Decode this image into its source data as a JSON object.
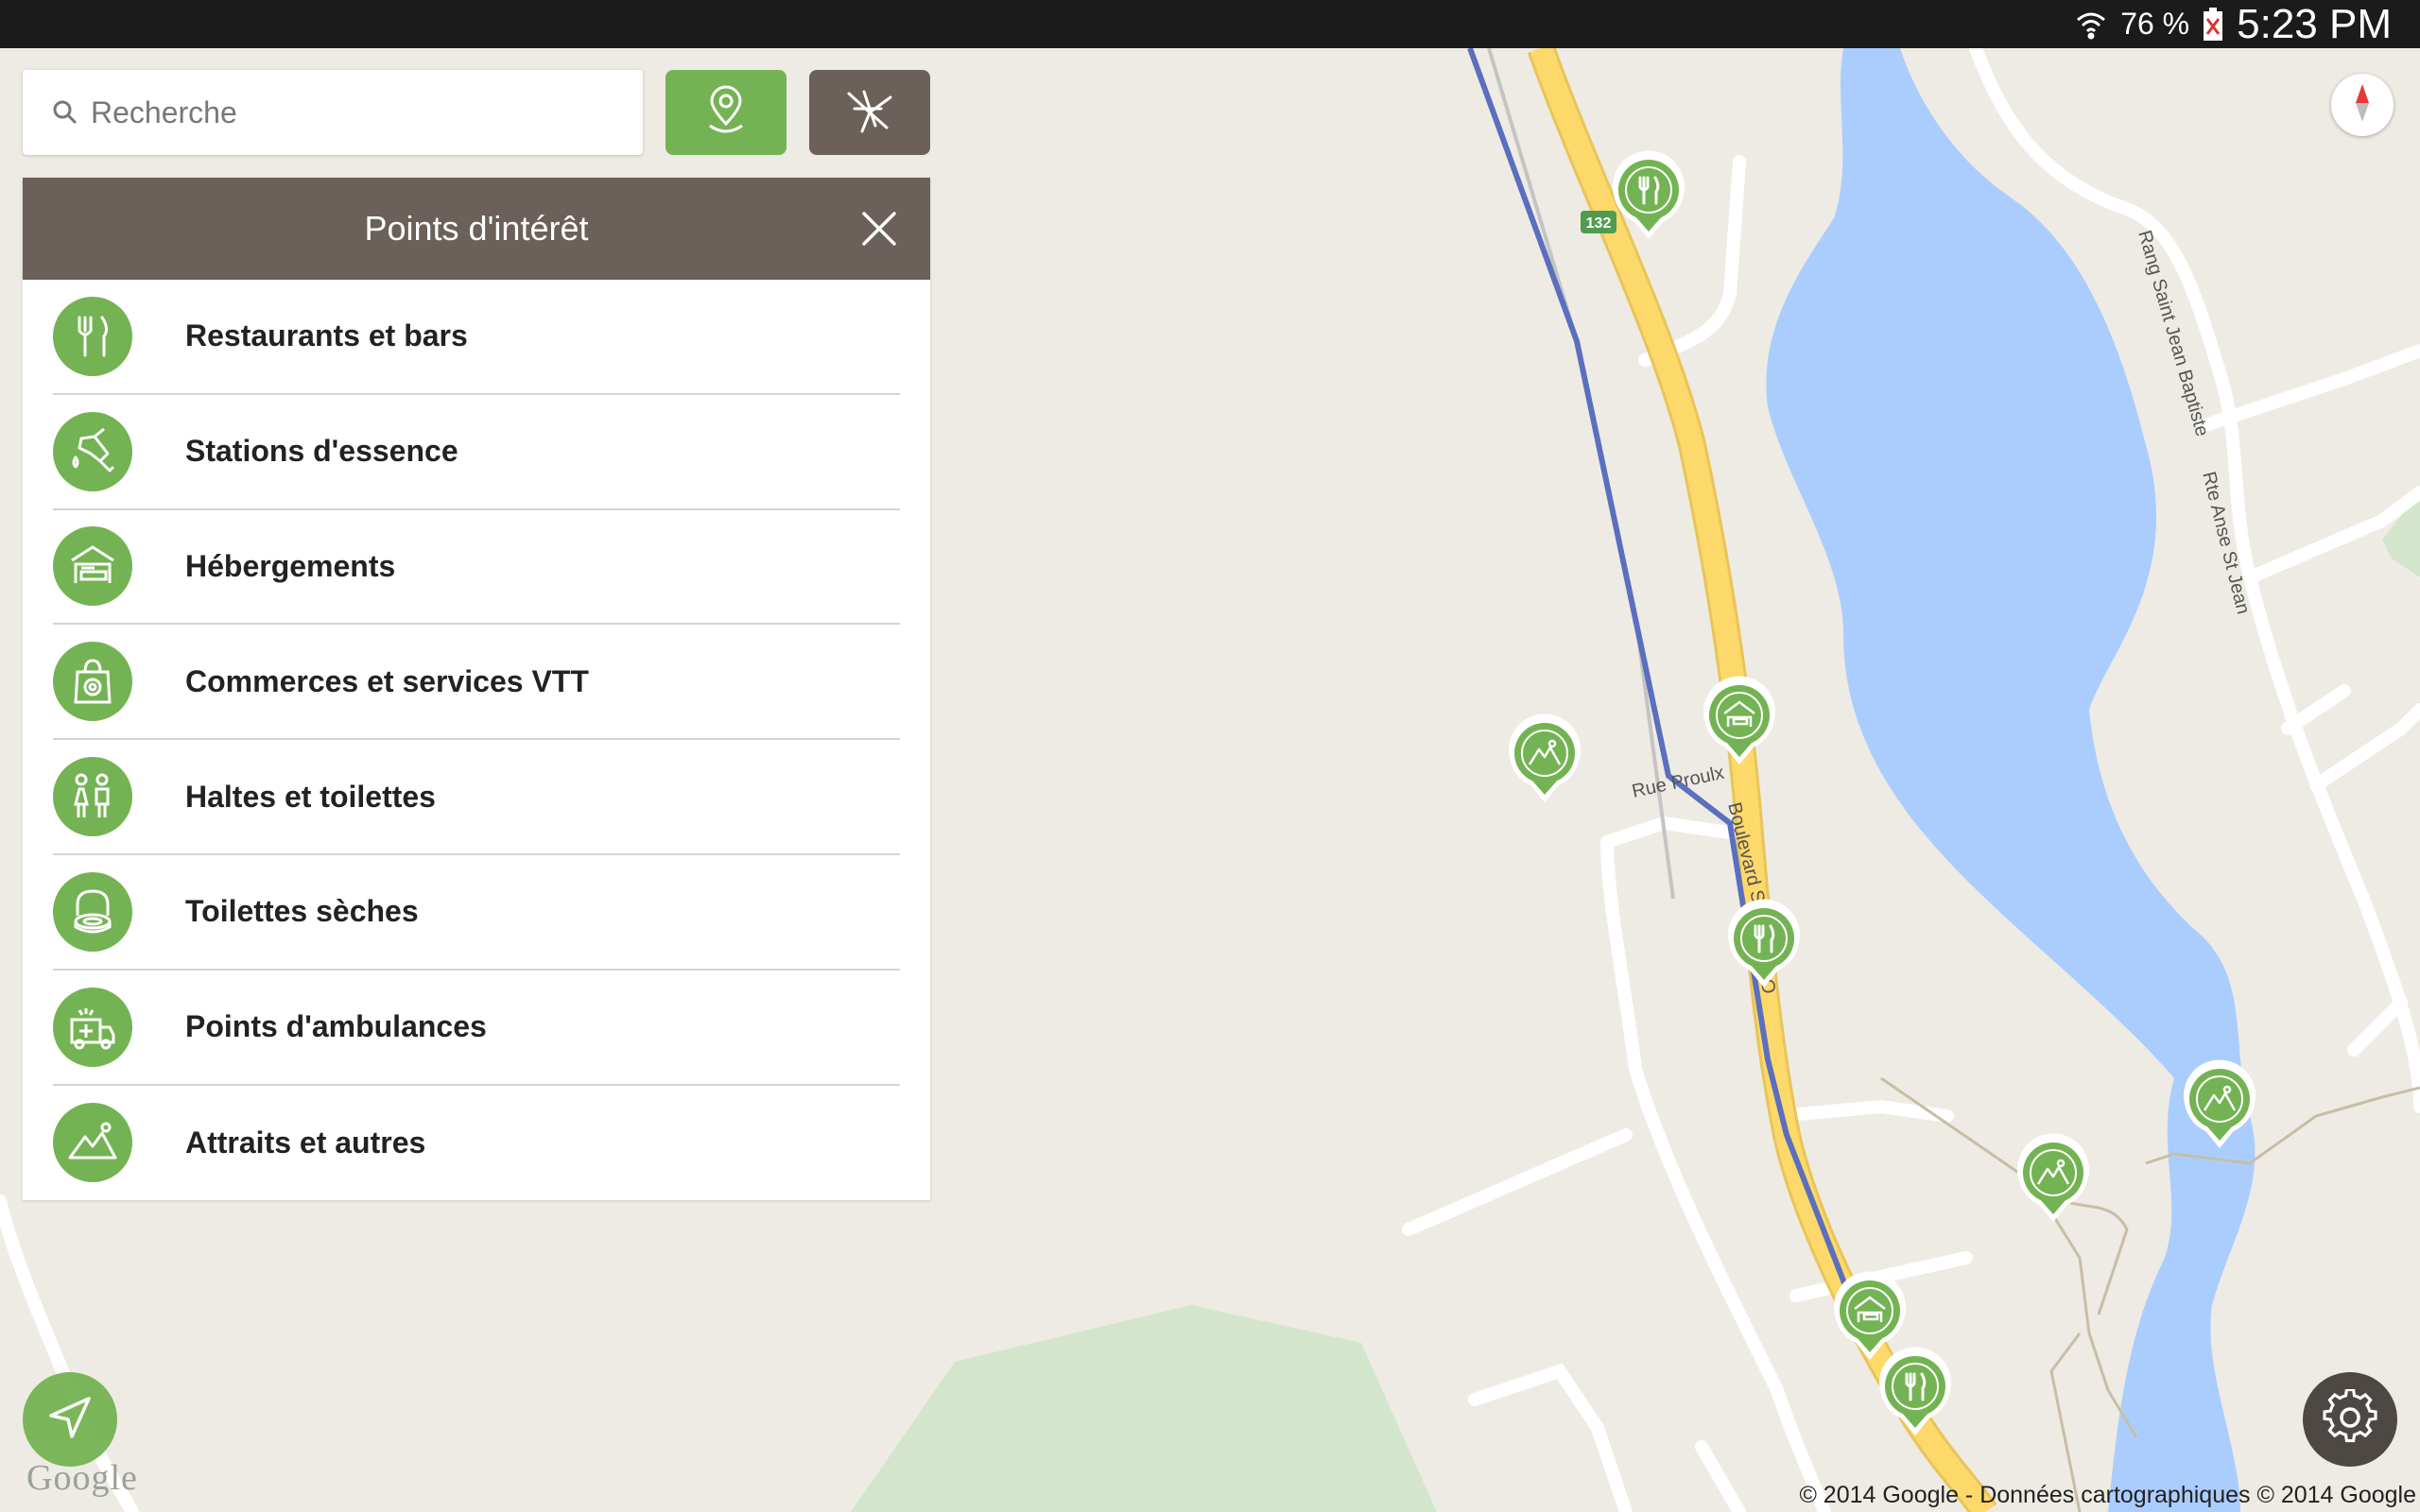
{
  "status_bar": {
    "battery_percent": "76 %",
    "time": "5:23 PM",
    "icons": [
      "wifi-icon",
      "battery-icon"
    ]
  },
  "search": {
    "placeholder": "Recherche"
  },
  "toolbar": {
    "poi_button_icon": "map-pin-icon",
    "trails_button_icon": "trails-network-icon"
  },
  "poi_panel": {
    "title": "Points d'intérêt",
    "items": [
      {
        "label": "Restaurants et bars",
        "icon": "fork-knife-icon"
      },
      {
        "label": "Stations d'essence",
        "icon": "fuel-nozzle-icon"
      },
      {
        "label": "Hébergements",
        "icon": "lodging-icon"
      },
      {
        "label": "Commerces et services VTT",
        "icon": "shopping-bag-icon"
      },
      {
        "label": "Haltes et toilettes",
        "icon": "restroom-icon"
      },
      {
        "label": "Toilettes sèches",
        "icon": "dry-toilet-icon"
      },
      {
        "label": "Points d'ambulances",
        "icon": "ambulance-icon"
      },
      {
        "label": "Attraits et autres",
        "icon": "mountain-icon"
      }
    ]
  },
  "map": {
    "route_shield": "132",
    "streets": {
      "rue_proulx": "Rue Proulx",
      "boulevard": "Boulevard S",
      "boulevard_suffix": "oit O",
      "rang_saint_jean": "Rang Saint Jean Baptiste",
      "rte_anse": "Rte Anse St Jean"
    },
    "markers": [
      {
        "type": "restaurant"
      },
      {
        "type": "lodging"
      },
      {
        "type": "attraction"
      },
      {
        "type": "restaurant"
      },
      {
        "type": "attraction"
      },
      {
        "type": "attraction"
      },
      {
        "type": "lodging"
      },
      {
        "type": "restaurant"
      }
    ],
    "google_logo": "Google",
    "copyright": "© 2014 Google - Données cartographiques © 2014 Google"
  },
  "colors": {
    "accent_green": "#74b353",
    "header_brown": "#6b615a",
    "water": "#abcdfe",
    "highway": "#fdd86b",
    "trail": "#5b6fbf"
  }
}
